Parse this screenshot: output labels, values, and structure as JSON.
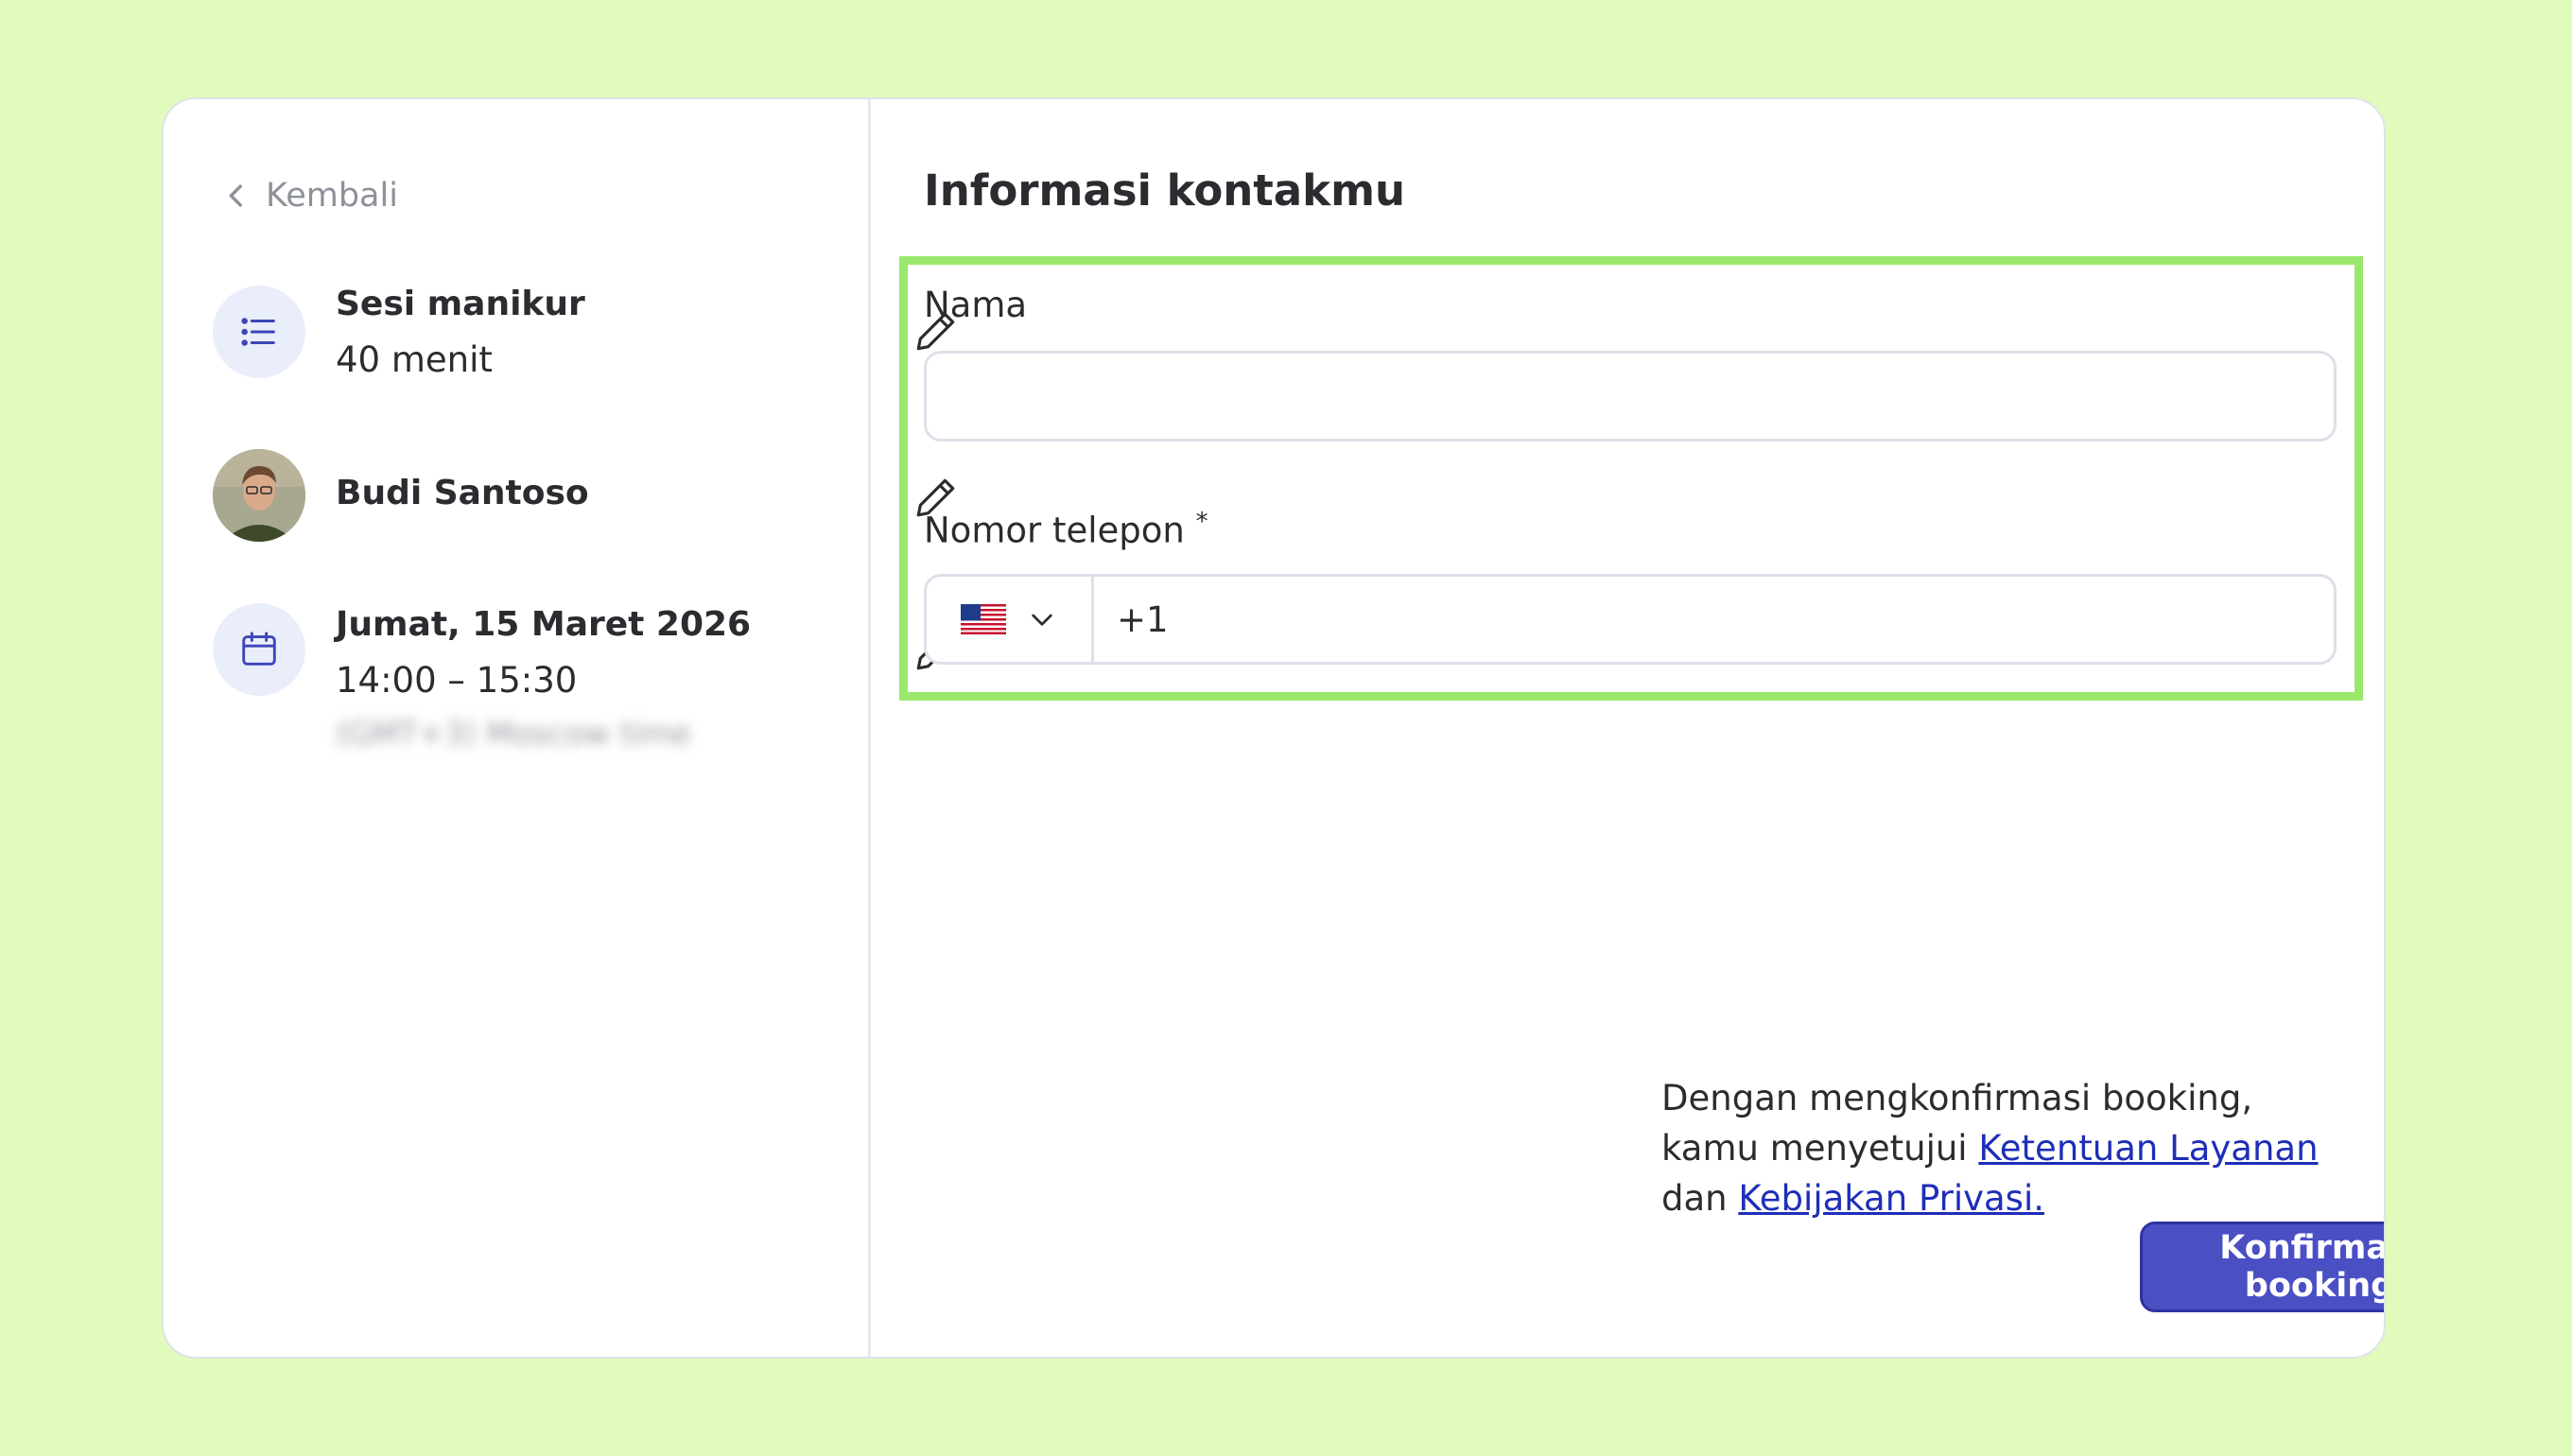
{
  "nav": {
    "back_label": "Kembali"
  },
  "summary": {
    "service": {
      "title": "Sesi manikur",
      "duration": "40 menit"
    },
    "specialist": {
      "name": "Budi Santoso"
    },
    "datetime": {
      "date": "Jumat, 15 Maret 2026",
      "time": "14:00 – 15:30",
      "timezone": "(GMT+3) Moscow time"
    }
  },
  "form": {
    "heading": "Informasi kontakmu",
    "name_label": "Nama",
    "name_value": "",
    "phone_label": "Nomor telepon",
    "phone_required_mark": "*",
    "phone_country": "US",
    "phone_value": "+1"
  },
  "consent": {
    "text_before": "Dengan mengkonfirmasi booking, kamu menyetujui ",
    "terms_link": "Ketentuan Layanan",
    "text_middle": " dan ",
    "privacy_link": "Kebijakan Privasi."
  },
  "actions": {
    "confirm_label": "Konfirmasi booking"
  },
  "colors": {
    "background": "#e1fbbd",
    "accent": "#4a4fc4",
    "highlight": "#99e86c",
    "link": "#1e2eb8"
  }
}
